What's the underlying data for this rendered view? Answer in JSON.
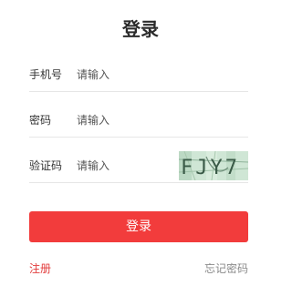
{
  "form": {
    "title": "登录",
    "phone": {
      "label": "手机号",
      "placeholder": "请输入",
      "value": ""
    },
    "password": {
      "label": "密码",
      "placeholder": "请输入",
      "value": ""
    },
    "captcha": {
      "label": "验证码",
      "placeholder": "请输入",
      "value": "",
      "image_text": "FJY7"
    },
    "login_button": "登录",
    "register_link": "注册",
    "forgot_link": "忘记密码"
  },
  "colors": {
    "primary": "#f23c3c",
    "register_link": "#e23c3c",
    "forgot_link": "#8a8a8a",
    "divider": "#e6e6e6"
  }
}
